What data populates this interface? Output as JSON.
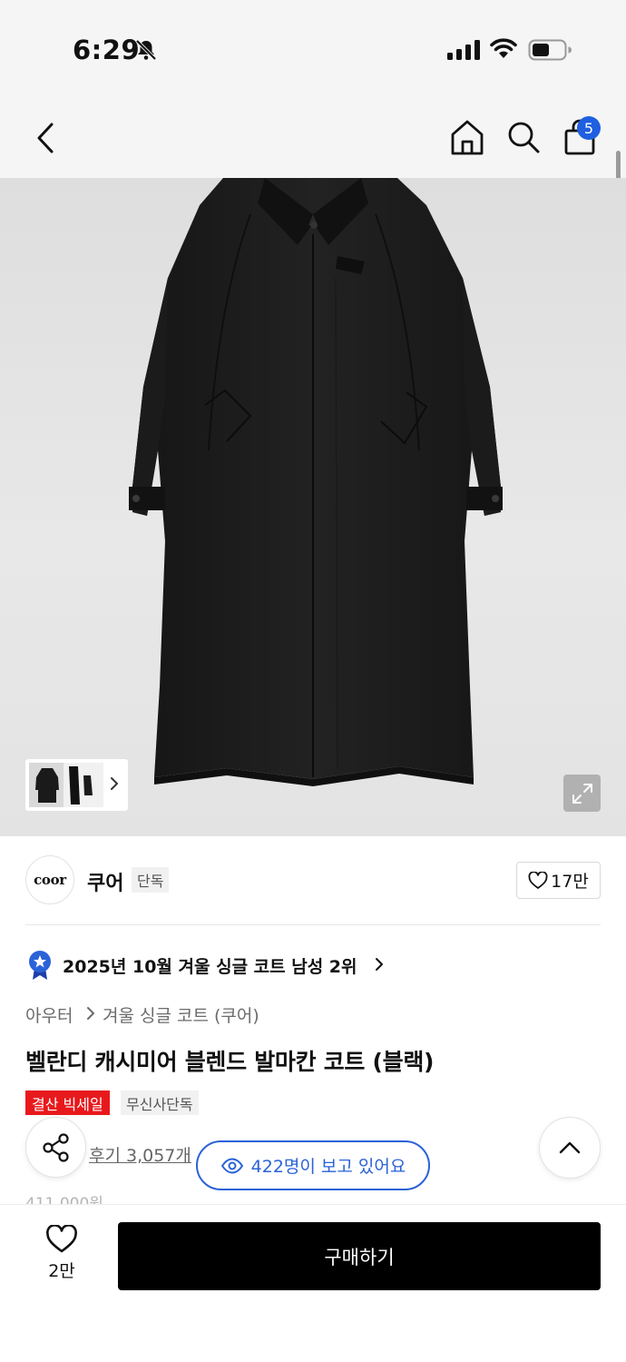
{
  "status_bar": {
    "time": "6:29",
    "icons": [
      "bell-off-icon",
      "cellular-signal-icon",
      "wifi-icon",
      "battery-icon"
    ]
  },
  "nav": {
    "icons": [
      "back-chevron-icon",
      "home-icon",
      "search-icon",
      "shopping-bag-icon"
    ],
    "cart_count": "5"
  },
  "hero": {
    "icons": [
      "thumbnail-chevron-right-icon",
      "expand-icon"
    ]
  },
  "brand": {
    "logo_text": "coor",
    "name": "쿠어",
    "tag": "단독",
    "like_count": "17만"
  },
  "ranking": {
    "text": "2025년 10월 겨울 싱글 코트 남성 2위"
  },
  "breadcrumb": {
    "category": "아우터",
    "subcategory": "겨울 싱글 코트 (쿠어)"
  },
  "product": {
    "title": "벨란디 캐시미어 블렌드 발마칸 코트 (블랙)",
    "tags": [
      "결산 빅세일",
      "무신사단독"
    ],
    "review_text": "후기 3,057개",
    "viewers_text": "422명이 보고 있어요",
    "price_peek": "411,000원"
  },
  "bottom_bar": {
    "wish_count": "2만",
    "buy_label": "구매하기"
  },
  "colors": {
    "accent_blue": "#2a62d8",
    "sale_red": "#e8191c",
    "buy_button": "#000000"
  }
}
